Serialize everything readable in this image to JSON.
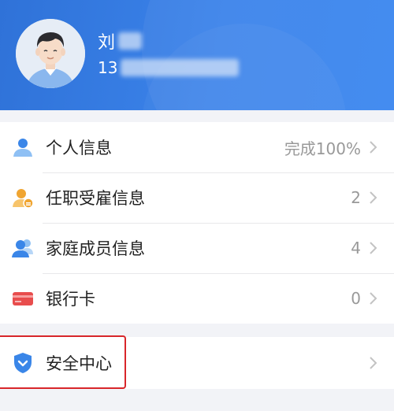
{
  "header": {
    "name_visible": "刘",
    "phone_visible": "13",
    "avatar_icon": "user-avatar-icon"
  },
  "info_list": [
    {
      "label": "个人信息",
      "value": "完成100%",
      "icon": "person-icon",
      "color": "#3a86e8"
    },
    {
      "label": "任职受雇信息",
      "value": "2",
      "icon": "employee-icon",
      "color": "#f0a531"
    },
    {
      "label": "家庭成员信息",
      "value": "4",
      "icon": "family-icon",
      "color": "#3a86e8"
    },
    {
      "label": "银行卡",
      "value": "0",
      "icon": "bank-card-icon",
      "color": "#e84d4d"
    }
  ],
  "security": {
    "label": "安全中心",
    "icon": "shield-icon",
    "color": "#3a86e8",
    "highlight_color": "#d8262a"
  }
}
